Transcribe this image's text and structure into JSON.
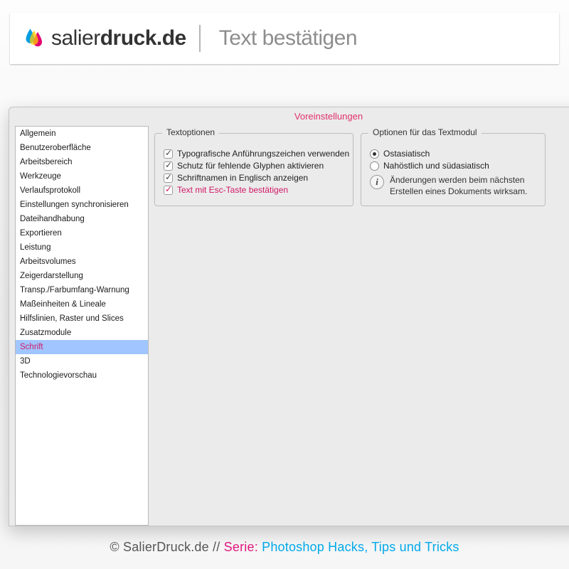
{
  "header": {
    "brand_light": "salier",
    "brand_bold": "druck.de",
    "subtitle": "Text bestätigen"
  },
  "prefs": {
    "window_title": "Voreinstellungen",
    "sidebar": [
      "Allgemein",
      "Benutzeroberfläche",
      "Arbeitsbereich",
      "Werkzeuge",
      "Verlaufsprotokoll",
      "Einstellungen synchronisieren",
      "Dateihandhabung",
      "Exportieren",
      "Leistung",
      "Arbeitsvolumes",
      "Zeigerdarstellung",
      "Transp./Farbumfang-Warnung",
      "Maßeinheiten & Lineale",
      "Hilfslinien, Raster und Slices",
      "Zusatzmodule",
      "Schrift",
      "3D",
      "Technologievorschau"
    ],
    "selected_index": 15,
    "textoptions": {
      "legend": "Textoptionen",
      "items": [
        {
          "label": "Typografische Anführungszeichen verwenden",
          "checked": true,
          "highlight": false
        },
        {
          "label": "Schutz für fehlende Glyphen aktivieren",
          "checked": true,
          "highlight": false
        },
        {
          "label": "Schriftnamen in Englisch anzeigen",
          "checked": true,
          "highlight": false
        },
        {
          "label": "Text mit Esc-Taste bestätigen",
          "checked": true,
          "highlight": true
        }
      ]
    },
    "textmodule": {
      "legend": "Optionen für das Textmodul",
      "radios": [
        {
          "label": "Ostasiatisch",
          "selected": true
        },
        {
          "label": "Nahöstlich und südasiatisch",
          "selected": false
        }
      ],
      "note": "Änderungen werden beim nächsten Erstellen eines Dokuments wirksam."
    }
  },
  "footer": {
    "copyright": "© SalierDruck.de //",
    "serie_label": "Serie:",
    "topic": "Photoshop Hacks, Tips und Tricks"
  }
}
